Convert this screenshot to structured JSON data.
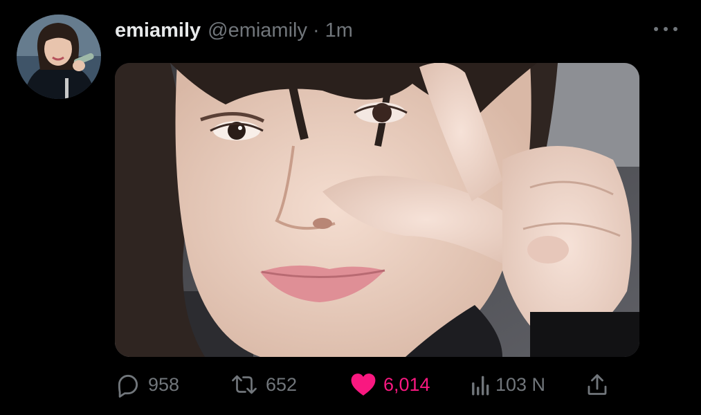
{
  "tweet": {
    "display_name": "emiamily",
    "handle": "@emiamily",
    "separator": "·",
    "timestamp": "1m"
  },
  "actions": {
    "replies": "958",
    "retweets": "652",
    "likes": "6,014",
    "views": "103 N"
  },
  "icons": {
    "reply": "reply-icon",
    "retweet": "retweet-icon",
    "like": "heart-icon",
    "views": "analytics-icon",
    "share": "share-icon",
    "more": "more-options-icon"
  },
  "colors": {
    "background": "#000000",
    "text_primary": "#e7e9ea",
    "text_secondary": "#71767b",
    "like_active": "#f91880"
  }
}
